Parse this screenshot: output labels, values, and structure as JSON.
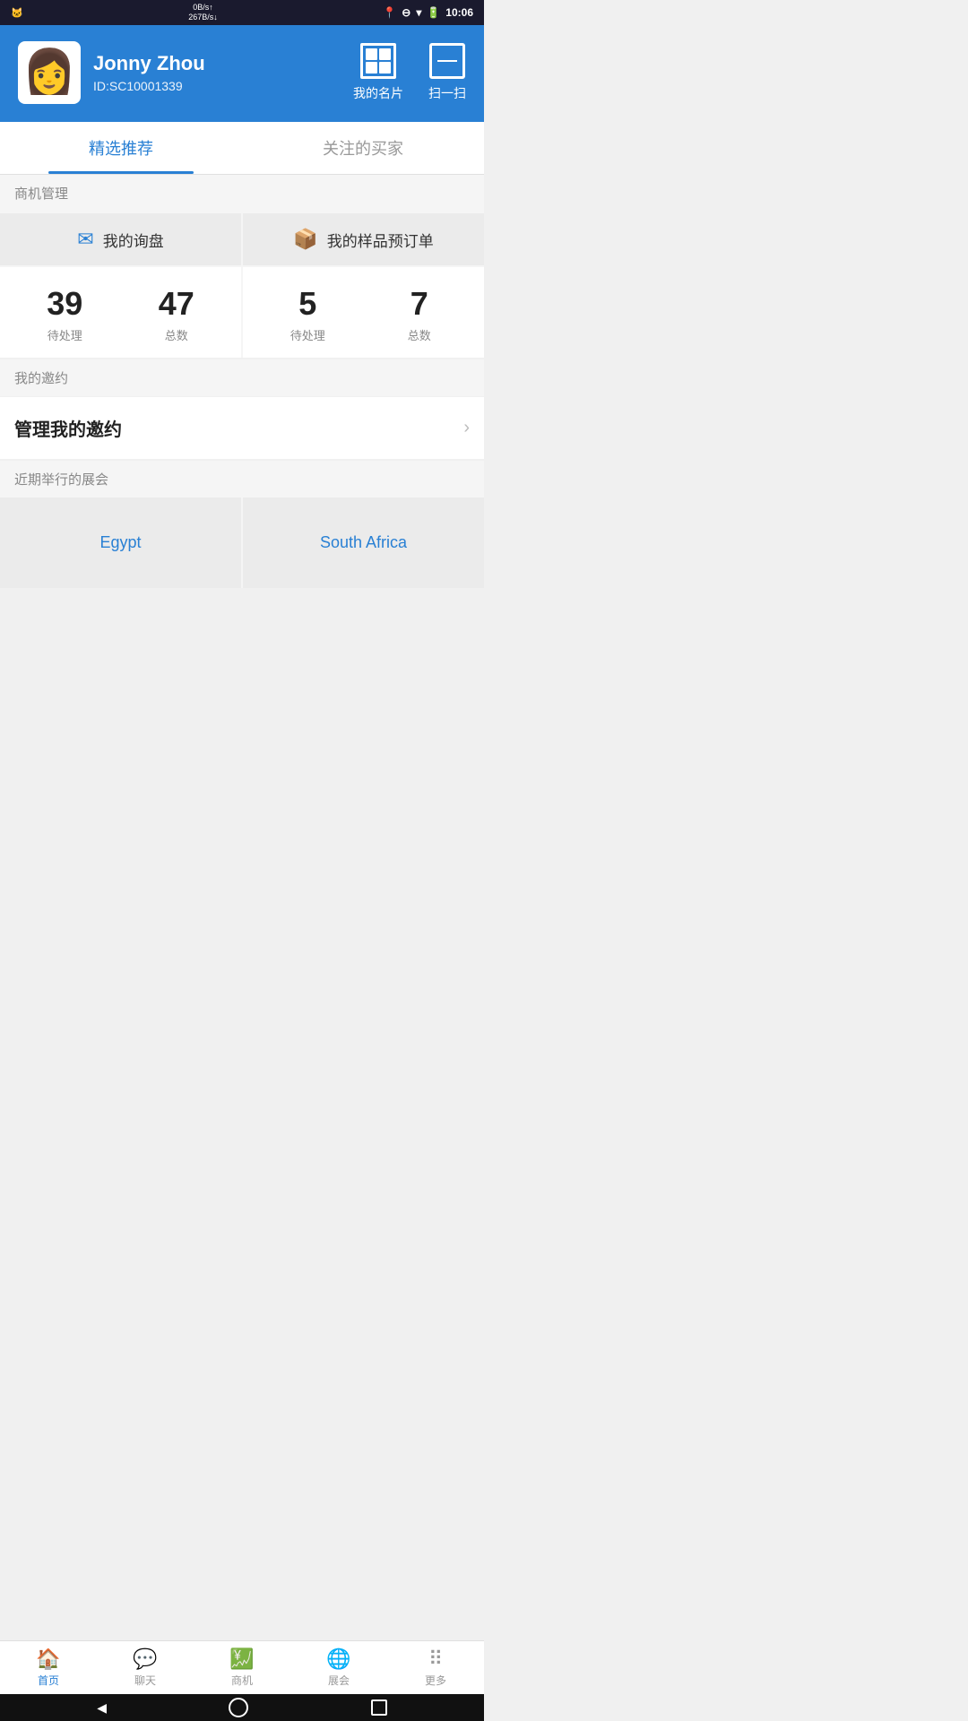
{
  "statusBar": {
    "network": "0B/s\n267B/s",
    "time": "10:06"
  },
  "header": {
    "userName": "Jonny Zhou",
    "userId": "ID:SC10001339",
    "myCard": "我的名片",
    "scan": "扫一扫"
  },
  "tabs": [
    {
      "label": "精选推荐",
      "active": true
    },
    {
      "label": "关注的买家",
      "active": false
    }
  ],
  "sections": {
    "business": {
      "label": "商机管理",
      "inquiry": {
        "label": "我的询盘",
        "pending": 39,
        "pendingLabel": "待处理",
        "total": 47,
        "totalLabel": "总数"
      },
      "sample": {
        "label": "我的样品预订单",
        "pending": 5,
        "pendingLabel": "待处理",
        "total": 7,
        "totalLabel": "总数"
      }
    },
    "invitation": {
      "sectionLabel": "我的邀约",
      "manageLabel": "管理我的邀约"
    },
    "exhibitions": {
      "sectionLabel": "近期举行的展会",
      "items": [
        {
          "name": "Egypt"
        },
        {
          "name": "South Africa"
        }
      ]
    }
  },
  "bottomNav": [
    {
      "label": "首页",
      "active": true,
      "icon": "home"
    },
    {
      "label": "聊天",
      "active": false,
      "icon": "chat"
    },
    {
      "label": "商机",
      "active": false,
      "icon": "business"
    },
    {
      "label": "展会",
      "active": false,
      "icon": "exhibition"
    },
    {
      "label": "更多",
      "active": false,
      "icon": "more"
    }
  ]
}
